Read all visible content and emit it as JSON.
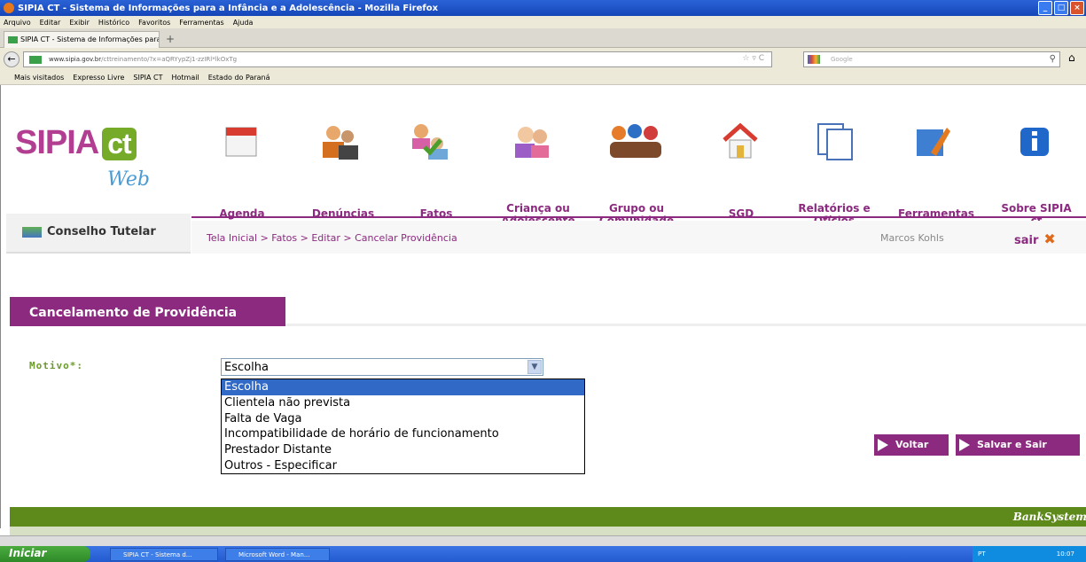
{
  "window": {
    "title": "SIPIA CT - Sistema de Informações para a Infância e a Adolescência - Mozilla Firefox"
  },
  "menu": [
    "Arquivo",
    "Editar",
    "Exibir",
    "Histórico",
    "Favoritos",
    "Ferramentas",
    "Ajuda"
  ],
  "tab": {
    "label": "SIPIA CT - Sistema de Informações para a I..."
  },
  "url": {
    "site": "www.sipia.gov.br",
    "path": "/cttreinamento/?x=aQRYypZj1-zzIRl*lkOxTg"
  },
  "search": {
    "placeholder": "Google"
  },
  "bookmarks": [
    "Mais visitados",
    "Expresso Livre",
    "SIPIA CT",
    "Hotmail",
    "Estado do Paraná"
  ],
  "logo": {
    "sipia": "SIPIA",
    "ct": "ct",
    "web": "Web",
    "module": "Conselho Tutelar"
  },
  "nav": [
    {
      "label": "Agenda"
    },
    {
      "label": "Denúncias"
    },
    {
      "label": "Fatos"
    },
    {
      "label": "Criança ou Adolescente"
    },
    {
      "label": "Grupo ou Comunidade"
    },
    {
      "label": "SGD"
    },
    {
      "label": "Relatórios e Ofícios"
    },
    {
      "label": "Ferramentas"
    },
    {
      "label": "Sobre SIPIA ct"
    }
  ],
  "breadcrumb": "Tela Inicial > Fatos > Editar > Cancelar Providência",
  "user": "Marcos Kohls",
  "logout": "sair",
  "section_title": "Cancelamento de Providência",
  "form": {
    "motivo_label": "Motivo*:",
    "selected": "Escolha",
    "options": [
      "Escolha",
      "Clientela não prevista",
      "Falta de Vaga",
      "Incompatibilidade de horário de funcionamento",
      "Prestador Distante",
      "Outros - Especificar"
    ]
  },
  "buttons": {
    "back": "Voltar",
    "save": "Salvar e Sair"
  },
  "footer": "BankSystem",
  "taskbar": {
    "start": "Iniciar",
    "tasks": [
      "SIPIA CT - Sistema d...",
      "Microsoft Word - Man..."
    ],
    "tray": "PT",
    "clock": "10:07"
  }
}
